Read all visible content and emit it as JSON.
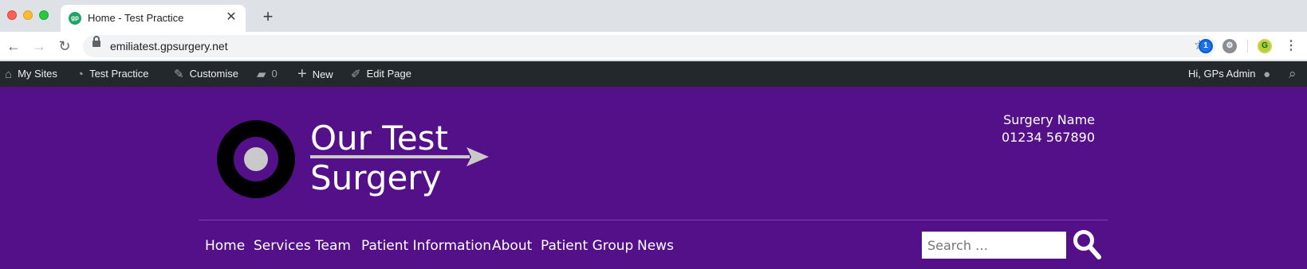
{
  "browser": {
    "tab": {
      "favicon_text": "gp",
      "title": "Home - Test Practice",
      "close": "✕"
    },
    "new_tab": "+",
    "nav": {
      "back": "←",
      "forward": "→",
      "reload": "↻"
    },
    "url": "emiliatest.gpsurgery.net",
    "bookmark_star": "☆",
    "extensions": {
      "onepass": "1",
      "gear": "⚙",
      "profile": "G",
      "menu": "⋮"
    }
  },
  "admin_bar": {
    "items": [
      {
        "icon": "wordpress-sites-icon",
        "glyph": "⌂",
        "label": "My Sites"
      },
      {
        "icon": "dashboard-icon",
        "glyph": "◔",
        "label": "Test Practice"
      },
      {
        "icon": "brush-icon",
        "glyph": "✎",
        "label": "Customise"
      },
      {
        "icon": "comment-icon",
        "glyph": "▰",
        "label": "0"
      },
      {
        "icon": "plus-icon",
        "glyph": "+",
        "label": "New"
      },
      {
        "icon": "pencil-icon",
        "glyph": "✐",
        "label": "Edit Page"
      }
    ],
    "greeting": "Hi, GPs Admin",
    "user_glyph": "●",
    "search_glyph": "⌕"
  },
  "site": {
    "logo": {
      "line1": "Our Test",
      "line2": "Surgery"
    },
    "contact": {
      "name": "Surgery Name",
      "phone": "01234 567890"
    },
    "nav": [
      "Home",
      "Services",
      "Team",
      "Patient Information",
      "About",
      "Patient Group",
      "News"
    ],
    "search": {
      "placeholder": "Search …"
    }
  },
  "colors": {
    "brand_purple": "#541089",
    "admin_bar": "#23282d",
    "logo_grey": "#c9c9c9"
  }
}
